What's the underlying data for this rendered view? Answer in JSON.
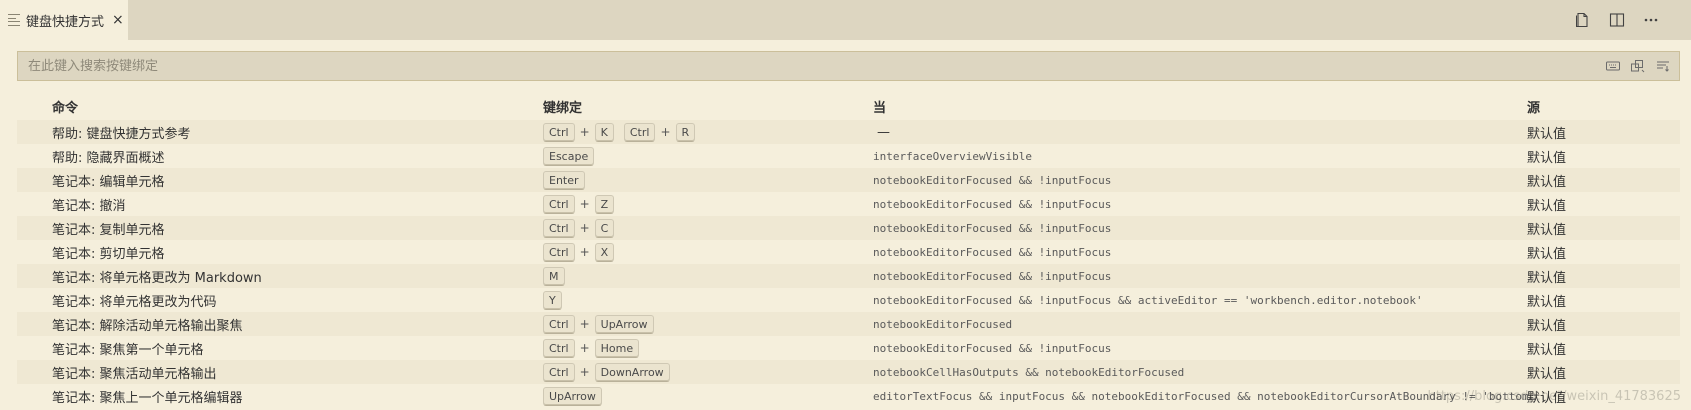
{
  "tab": {
    "title": "键盘快捷方式",
    "close_symbol": "×"
  },
  "search": {
    "placeholder": "在此键入搜索按键绑定"
  },
  "header": {
    "command": "命令",
    "keybinding": "键绑定",
    "when": "当",
    "source": "源"
  },
  "rows": [
    {
      "command": "帮助: 键盘快捷方式参考",
      "chords": [
        [
          "Ctrl",
          "K"
        ],
        [
          "Ctrl",
          "R"
        ]
      ],
      "when": "—",
      "source": "默认值"
    },
    {
      "command": "帮助: 隐藏界面概述",
      "chords": [
        [
          "Escape"
        ]
      ],
      "when": "interfaceOverviewVisible",
      "source": "默认值"
    },
    {
      "command": "笔记本: 编辑单元格",
      "chords": [
        [
          "Enter"
        ]
      ],
      "when": "notebookEditorFocused && !inputFocus",
      "source": "默认值"
    },
    {
      "command": "笔记本: 撤消",
      "chords": [
        [
          "Ctrl",
          "Z"
        ]
      ],
      "when": "notebookEditorFocused && !inputFocus",
      "source": "默认值"
    },
    {
      "command": "笔记本: 复制单元格",
      "chords": [
        [
          "Ctrl",
          "C"
        ]
      ],
      "when": "notebookEditorFocused && !inputFocus",
      "source": "默认值"
    },
    {
      "command": "笔记本: 剪切单元格",
      "chords": [
        [
          "Ctrl",
          "X"
        ]
      ],
      "when": "notebookEditorFocused && !inputFocus",
      "source": "默认值"
    },
    {
      "command": "笔记本: 将单元格更改为 Markdown",
      "chords": [
        [
          "M"
        ]
      ],
      "when": "notebookEditorFocused && !inputFocus",
      "source": "默认值"
    },
    {
      "command": "笔记本: 将单元格更改为代码",
      "chords": [
        [
          "Y"
        ]
      ],
      "when": "notebookEditorFocused && !inputFocus && activeEditor == 'workbench.editor.notebook'",
      "source": "默认值"
    },
    {
      "command": "笔记本: 解除活动单元格输出聚焦",
      "chords": [
        [
          "Ctrl",
          "UpArrow"
        ]
      ],
      "when": "notebookEditorFocused",
      "source": "默认值"
    },
    {
      "command": "笔记本: 聚焦第一个单元格",
      "chords": [
        [
          "Ctrl",
          "Home"
        ]
      ],
      "when": "notebookEditorFocused && !inputFocus",
      "source": "默认值"
    },
    {
      "command": "笔记本: 聚焦活动单元格输出",
      "chords": [
        [
          "Ctrl",
          "DownArrow"
        ]
      ],
      "when": "notebookCellHasOutputs && notebookEditorFocused",
      "source": "默认值"
    },
    {
      "command": "笔记本: 聚焦上一个单元格编辑器",
      "chords": [
        [
          "UpArrow"
        ]
      ],
      "when": "editorTextFocus && inputFocus && notebookEditorFocused && notebookEditorCursorAtBoundary != 'bottom…",
      "source": "默认值"
    }
  ],
  "watermark": "https://blog.csdn.net/weixin_41783625",
  "colors": {
    "background": "#f5efdc",
    "tabbar": "#ddd6c1",
    "stripe": "#efe8d3",
    "search_border": "#cbbf9a"
  }
}
